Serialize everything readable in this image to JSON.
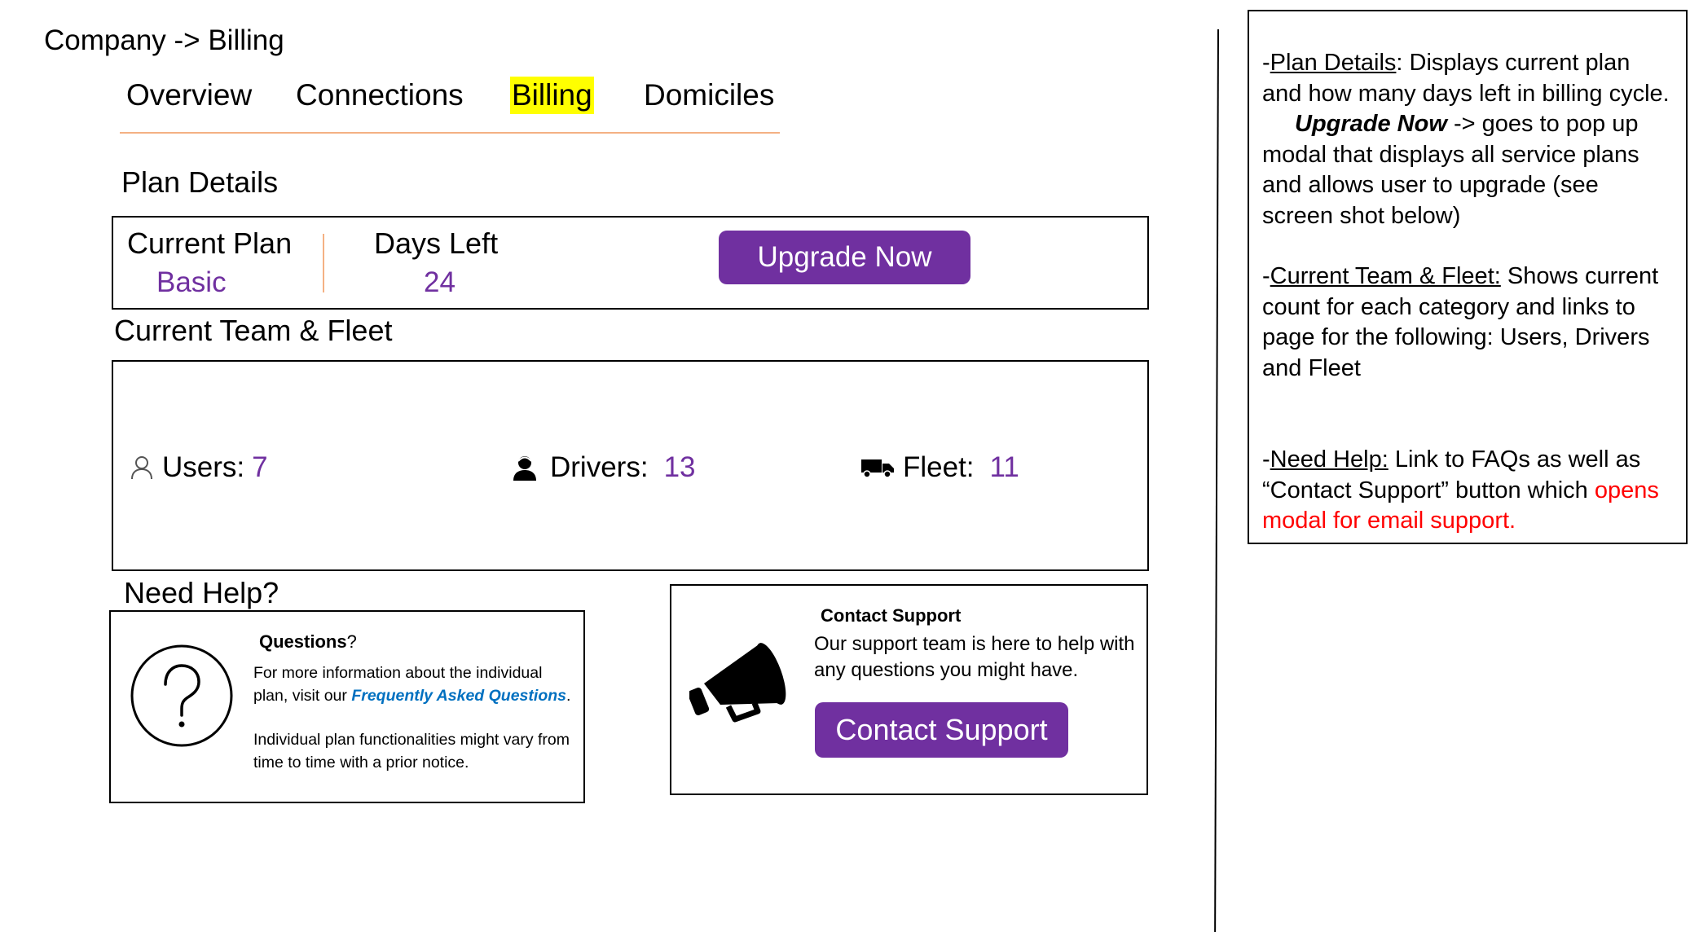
{
  "breadcrumb": "Company -> Billing",
  "tabs": [
    {
      "label": "Overview"
    },
    {
      "label": "Connections"
    },
    {
      "label": "Billing",
      "highlighted": true
    },
    {
      "label": "Domiciles"
    }
  ],
  "plan_details": {
    "heading": "Plan Details",
    "current_plan_label": "Current Plan",
    "current_plan_value": "Basic",
    "days_left_label": "Days Left",
    "days_left_value": "24",
    "upgrade_button": "Upgrade Now"
  },
  "team_fleet": {
    "heading": "Current Team & Fleet",
    "users_label": "Users:",
    "users_value": "7",
    "drivers_label": "Drivers:",
    "drivers_value": "13",
    "fleet_label": "Fleet:",
    "fleet_value": "11",
    "icons": [
      "user-icon",
      "driver-icon",
      "truck-icon"
    ]
  },
  "help": {
    "heading": "Need Help?",
    "questions_title": "Questions",
    "questions_title_suffix": "?",
    "questions_text_before_link": "For more information about the individual plan, visit our ",
    "faq_link": "Frequently Asked Questions",
    "questions_text_after_link": ".",
    "questions_note": "Individual plan functionalities might vary from time to time with a prior notice.",
    "contact_title": "Contact Support",
    "contact_text": "Our support team is here to help with any questions you might have.",
    "contact_button": "Contact Support",
    "icons": [
      "question-mark-icon",
      "megaphone-icon"
    ]
  },
  "notes": {
    "plan_prefix": "-",
    "plan_label": "Plan Details",
    "plan_text": ": Displays current plan and how many days left in billing cycle.",
    "upgrade_label": "Upgrade Now",
    "upgrade_text": " -> goes to pop up modal that displays all service plans and allows user to upgrade (see screen shot below)",
    "team_prefix": "-",
    "team_label": "Current Team & Fleet:",
    "team_text": "  Shows current count for each category and links to page for the following:  Users, Drivers and Fleet",
    "help_prefix": "-",
    "help_label": "Need Help:",
    "help_text": "  Link to FAQs as well as “Contact Support” button which ",
    "help_text_red": "opens modal for email support."
  },
  "colors": {
    "accent": "#7030a0",
    "highlight": "#ffff00",
    "tab_underline": "#f4b183",
    "faq_link": "#0070c0",
    "warning_text": "#ff0000"
  }
}
